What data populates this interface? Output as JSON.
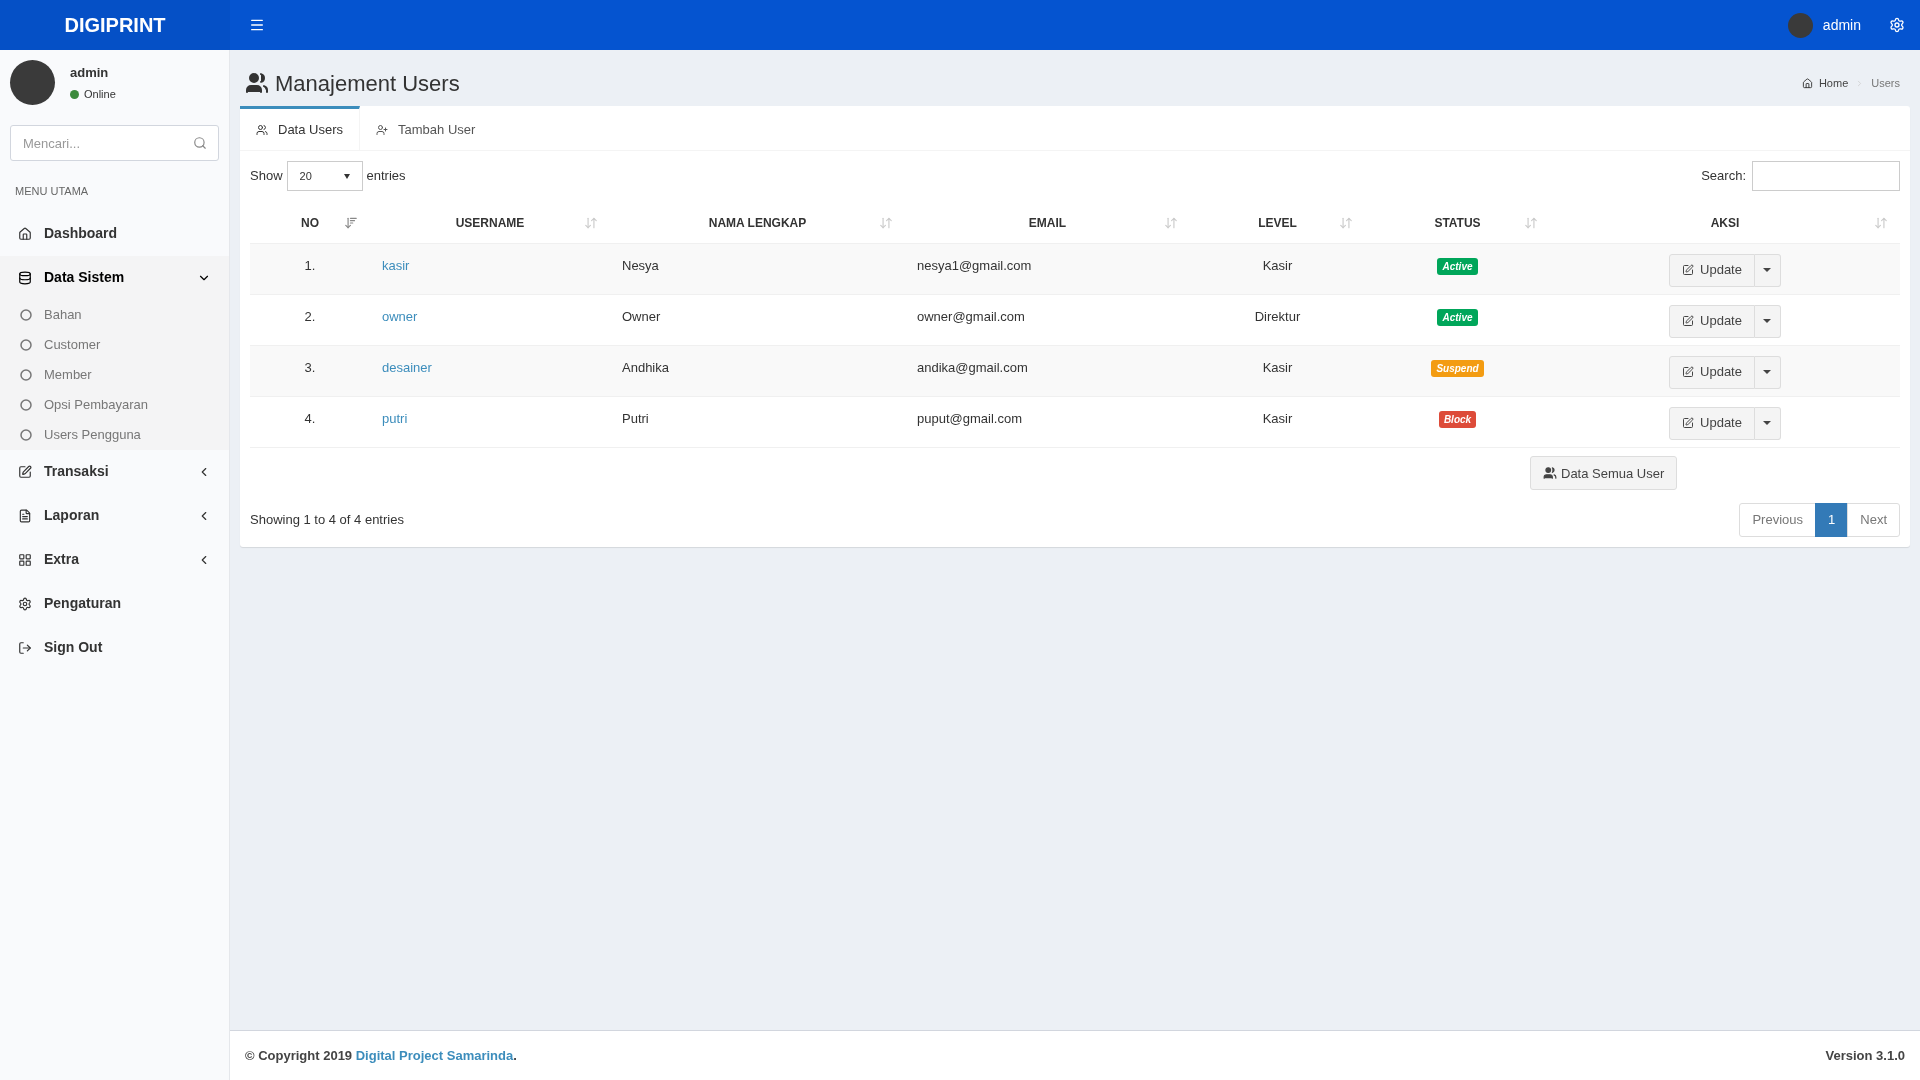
{
  "brand": "DIGIPRINT",
  "topbar": {
    "user": "admin"
  },
  "sidebar": {
    "user": {
      "name": "admin",
      "status": "Online",
      "online": true
    },
    "search": {
      "placeholder": "Mencari..."
    },
    "header": "MENU UTAMA",
    "items": [
      {
        "kind": "link",
        "label": "Dashboard"
      },
      {
        "kind": "group",
        "label": "Data Sistem",
        "expanded": true,
        "children": [
          {
            "label": "Bahan"
          },
          {
            "label": "Customer"
          },
          {
            "label": "Member"
          },
          {
            "label": "Opsi Pembayaran"
          },
          {
            "label": "Users Pengguna"
          }
        ]
      },
      {
        "kind": "group",
        "label": "Transaksi",
        "expanded": false
      },
      {
        "kind": "group",
        "label": "Laporan",
        "expanded": false
      },
      {
        "kind": "group",
        "label": "Extra",
        "expanded": false
      },
      {
        "kind": "link",
        "label": "Pengaturan"
      },
      {
        "kind": "link",
        "label": "Sign Out"
      }
    ]
  },
  "page": {
    "title": "Manajement Users",
    "breadcrumb": [
      "Home",
      "Users"
    ]
  },
  "tabs": [
    {
      "label": "Data Users",
      "selected": true
    },
    {
      "label": "Tambah User",
      "selected": false
    }
  ],
  "table": {
    "show_label": "Show",
    "length": "20",
    "entries_label": "entries",
    "search_label": "Search:",
    "columns": [
      {
        "label": "NO",
        "sorted": true
      },
      {
        "label": "USERNAME",
        "sorted": false
      },
      {
        "label": "NAMA LENGKAP",
        "sorted": false
      },
      {
        "label": "EMAIL",
        "sorted": false
      },
      {
        "label": "LEVEL",
        "sorted": false
      },
      {
        "label": "STATUS",
        "sorted": false
      },
      {
        "label": "AKSI",
        "sorted": false
      }
    ],
    "rows": [
      {
        "no": "1.",
        "username": "kasir",
        "name": "Nesya",
        "email": "nesya1@gmail.com",
        "level": "Kasir",
        "status": {
          "label": "Active",
          "color": "#00a65a"
        },
        "action": "Update"
      },
      {
        "no": "2.",
        "username": "owner",
        "name": "Owner",
        "email": "owner@gmail.com",
        "level": "Direktur",
        "status": {
          "label": "Active",
          "color": "#00a65a"
        },
        "action": "Update"
      },
      {
        "no": "3.",
        "username": "desainer",
        "name": "Andhika",
        "email": "andika@gmail.com",
        "level": "Kasir",
        "status": {
          "label": "Suspend",
          "color": "#f39c12"
        },
        "action": "Update"
      },
      {
        "no": "4.",
        "username": "putri",
        "name": "Putri",
        "email": "puput@gmail.com",
        "level": "Kasir",
        "status": {
          "label": "Block",
          "color": "#dd4b39"
        },
        "action": "Update"
      }
    ],
    "all_button": "Data Semua User",
    "info": "Showing 1 to 4 of 4 entries",
    "pagination": [
      {
        "label": "Previous",
        "selected": false
      },
      {
        "label": "1",
        "selected": true
      },
      {
        "label": "Next",
        "selected": false
      }
    ]
  },
  "footer": {
    "copyright": "© Copyright 2019",
    "link": "Digital Project Samarinda",
    "suffix": ".",
    "version": "Version 3.1.0"
  }
}
